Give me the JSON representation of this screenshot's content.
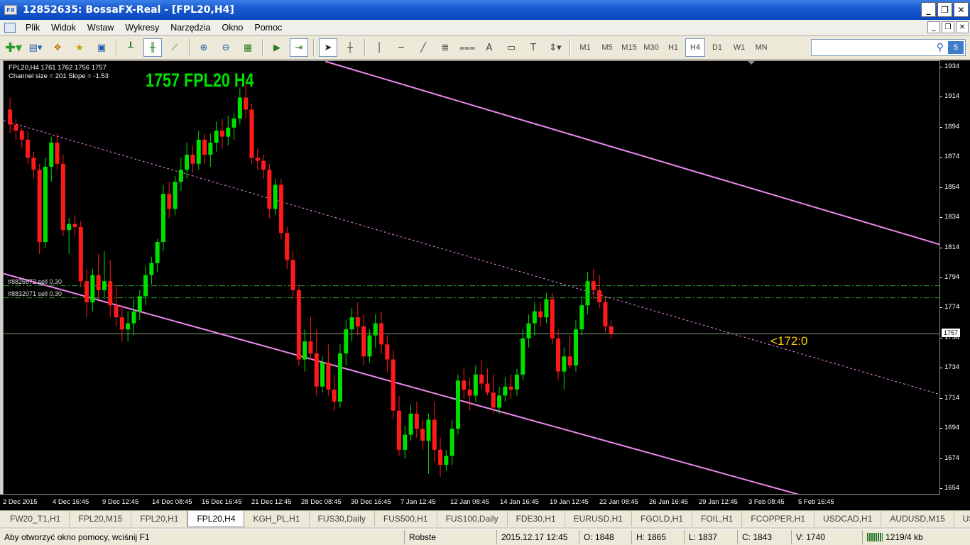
{
  "window": {
    "title": "12852635: BossaFX-Real - [FPL20,H4]",
    "app_icon": "FX"
  },
  "menu": [
    "Plik",
    "Widok",
    "Wstaw",
    "Wykresy",
    "Narzędzia",
    "Okno",
    "Pomoc"
  ],
  "toolbar": {
    "timeframes": [
      "M1",
      "M5",
      "M15",
      "M30",
      "H1",
      "H4",
      "D1",
      "W1",
      "MN"
    ],
    "selected_timeframe": "H4",
    "search_placeholder": "",
    "badge": "5"
  },
  "chart": {
    "info_line1": "FPL20,H4  1761 1762 1756 1757",
    "info_line2": "Channel size = 201 Slope = -1.53",
    "big_label": "1757 FPL20 H4",
    "countdown": "<172:0",
    "order1": "#8826572 sell 0.30",
    "order2": "#8832071 sell 0.30",
    "current_price": "1757",
    "price_labels": [
      "1934",
      "1914",
      "1894",
      "1874",
      "1854",
      "1834",
      "1814",
      "1794",
      "1774",
      "1754",
      "1734",
      "1714",
      "1694",
      "1674",
      "1654"
    ],
    "time_labels": [
      "2 Dec 2015",
      "4 Dec 16:45",
      "9 Dec 12:45",
      "14 Dec 08:45",
      "16 Dec 16:45",
      "21 Dec 12:45",
      "28 Dec 08:45",
      "30 Dec 16:45",
      "7 Jan 12:45",
      "12 Jan 08:45",
      "14 Jan 16:45",
      "19 Jan 12:45",
      "22 Jan 08:45",
      "26 Jan 16:45",
      "29 Jan 12:45",
      "3 Feb 08:45",
      "5 Feb 16:45"
    ],
    "colors": {
      "bull": "#00e000",
      "bear": "#ff1a1a",
      "channel": "#ee88ee",
      "order_line": "#2ea02e",
      "price_line": "#7fa37f",
      "background": "#000000"
    }
  },
  "chart_data": {
    "type": "candlestick",
    "symbol": "FPL20",
    "timeframe": "H4",
    "ylim": [
      1650,
      1938
    ],
    "last_price": 1757,
    "orders": [
      {
        "label": "#8826572 sell 0.30",
        "price": 1789
      },
      {
        "label": "#8832071 sell 0.30",
        "price": 1781
      }
    ],
    "channel": {
      "upper": [
        {
          "bar": 54,
          "price": 1938
        },
        {
          "bar": 222,
          "price": 1742
        }
      ],
      "middle": [
        {
          "bar": 0,
          "price": 1898
        },
        {
          "bar": 214,
          "price": 1653
        }
      ],
      "lower": [
        {
          "bar": 0,
          "price": 1797
        },
        {
          "bar": 128,
          "price": 1652
        }
      ]
    },
    "candles": [
      [
        1906,
        1914,
        1890,
        1896
      ],
      [
        1896,
        1900,
        1886,
        1892
      ],
      [
        1892,
        1894,
        1880,
        1886
      ],
      [
        1886,
        1892,
        1870,
        1874
      ],
      [
        1874,
        1878,
        1860,
        1866
      ],
      [
        1866,
        1870,
        1810,
        1818
      ],
      [
        1818,
        1874,
        1814,
        1868
      ],
      [
        1868,
        1888,
        1858,
        1884
      ],
      [
        1884,
        1890,
        1866,
        1870
      ],
      [
        1870,
        1876,
        1822,
        1826
      ],
      [
        1826,
        1834,
        1810,
        1830
      ],
      [
        1830,
        1836,
        1822,
        1828
      ],
      [
        1828,
        1832,
        1788,
        1792
      ],
      [
        1792,
        1800,
        1768,
        1778
      ],
      [
        1778,
        1800,
        1772,
        1796
      ],
      [
        1796,
        1810,
        1780,
        1786
      ],
      [
        1786,
        1812,
        1780,
        1792
      ],
      [
        1792,
        1806,
        1768,
        1776
      ],
      [
        1776,
        1790,
        1762,
        1768
      ],
      [
        1768,
        1776,
        1752,
        1760
      ],
      [
        1760,
        1772,
        1752,
        1764
      ],
      [
        1764,
        1780,
        1756,
        1772
      ],
      [
        1772,
        1786,
        1766,
        1782
      ],
      [
        1782,
        1802,
        1776,
        1796
      ],
      [
        1796,
        1808,
        1790,
        1804
      ],
      [
        1804,
        1820,
        1798,
        1818
      ],
      [
        1818,
        1856,
        1812,
        1850
      ],
      [
        1850,
        1858,
        1834,
        1840
      ],
      [
        1840,
        1862,
        1836,
        1858
      ],
      [
        1858,
        1874,
        1852,
        1866
      ],
      [
        1866,
        1884,
        1860,
        1876
      ],
      [
        1876,
        1882,
        1864,
        1870
      ],
      [
        1870,
        1892,
        1866,
        1886
      ],
      [
        1886,
        1890,
        1870,
        1876
      ],
      [
        1876,
        1890,
        1868,
        1884
      ],
      [
        1884,
        1898,
        1878,
        1892
      ],
      [
        1892,
        1900,
        1880,
        1888
      ],
      [
        1888,
        1902,
        1882,
        1894
      ],
      [
        1894,
        1904,
        1886,
        1900
      ],
      [
        1900,
        1920,
        1896,
        1914
      ],
      [
        1914,
        1924,
        1900,
        1906
      ],
      [
        1906,
        1910,
        1870,
        1874
      ],
      [
        1874,
        1880,
        1866,
        1872
      ],
      [
        1872,
        1876,
        1860,
        1866
      ],
      [
        1866,
        1870,
        1834,
        1840
      ],
      [
        1840,
        1860,
        1836,
        1856
      ],
      [
        1856,
        1860,
        1820,
        1824
      ],
      [
        1824,
        1828,
        1800,
        1806
      ],
      [
        1806,
        1812,
        1780,
        1786
      ],
      [
        1786,
        1790,
        1736,
        1740
      ],
      [
        1740,
        1760,
        1732,
        1752
      ],
      [
        1752,
        1768,
        1740,
        1744
      ],
      [
        1744,
        1760,
        1716,
        1722
      ],
      [
        1722,
        1742,
        1718,
        1738
      ],
      [
        1738,
        1750,
        1716,
        1720
      ],
      [
        1720,
        1730,
        1706,
        1712
      ],
      [
        1712,
        1750,
        1708,
        1744
      ],
      [
        1744,
        1766,
        1736,
        1760
      ],
      [
        1760,
        1774,
        1752,
        1768
      ],
      [
        1768,
        1778,
        1756,
        1762
      ],
      [
        1762,
        1770,
        1736,
        1742
      ],
      [
        1742,
        1760,
        1738,
        1756
      ],
      [
        1756,
        1770,
        1748,
        1764
      ],
      [
        1764,
        1772,
        1744,
        1750
      ],
      [
        1750,
        1756,
        1732,
        1740
      ],
      [
        1740,
        1746,
        1700,
        1706
      ],
      [
        1706,
        1716,
        1676,
        1680
      ],
      [
        1680,
        1696,
        1674,
        1690
      ],
      [
        1690,
        1710,
        1686,
        1704
      ],
      [
        1704,
        1712,
        1688,
        1694
      ],
      [
        1694,
        1700,
        1680,
        1686
      ],
      [
        1686,
        1704,
        1664,
        1700
      ],
      [
        1700,
        1712,
        1672,
        1680
      ],
      [
        1680,
        1688,
        1662,
        1670
      ],
      [
        1670,
        1680,
        1666,
        1676
      ],
      [
        1676,
        1700,
        1670,
        1694
      ],
      [
        1694,
        1730,
        1690,
        1726
      ],
      [
        1726,
        1734,
        1714,
        1720
      ],
      [
        1720,
        1728,
        1706,
        1716
      ],
      [
        1716,
        1736,
        1712,
        1730
      ],
      [
        1730,
        1740,
        1720,
        1724
      ],
      [
        1724,
        1734,
        1716,
        1718
      ],
      [
        1718,
        1730,
        1704,
        1708
      ],
      [
        1708,
        1722,
        1704,
        1716
      ],
      [
        1716,
        1728,
        1712,
        1722
      ],
      [
        1722,
        1730,
        1714,
        1720
      ],
      [
        1720,
        1734,
        1716,
        1730
      ],
      [
        1730,
        1760,
        1726,
        1754
      ],
      [
        1754,
        1770,
        1748,
        1764
      ],
      [
        1764,
        1778,
        1756,
        1772
      ],
      [
        1772,
        1778,
        1762,
        1768
      ],
      [
        1768,
        1784,
        1764,
        1780
      ],
      [
        1780,
        1784,
        1750,
        1754
      ],
      [
        1754,
        1760,
        1726,
        1732
      ],
      [
        1732,
        1748,
        1720,
        1742
      ],
      [
        1742,
        1756,
        1734,
        1736
      ],
      [
        1736,
        1766,
        1732,
        1760
      ],
      [
        1760,
        1782,
        1756,
        1776
      ],
      [
        1776,
        1798,
        1770,
        1792
      ],
      [
        1792,
        1800,
        1780,
        1786
      ],
      [
        1786,
        1796,
        1774,
        1778
      ],
      [
        1778,
        1782,
        1758,
        1762
      ],
      [
        1762,
        1766,
        1754,
        1757
      ]
    ]
  },
  "tabs": [
    "FW20_T1,H1",
    "FPL20,M15",
    "FPL20,H1",
    "FPL20,H4",
    "KGH_PL,H1",
    "FUS30,Daily",
    "FUS500,H1",
    "FUS100,Daily",
    "FDE30,H1",
    "EURUSD,H1",
    "FGOLD,H1",
    "FOIL,H1",
    "FCOPPER,H1",
    "USDCAD,H1",
    "AUDUSD,M15",
    "USD"
  ],
  "active_tab": "FPL20,H4",
  "status": {
    "help": "Aby otworzyć okno pomocy, wciśnij F1",
    "profile": "Robste",
    "datetime": "2015.12.17 12:45",
    "open": "O: 1848",
    "high": "H: 1865",
    "low": "L: 1837",
    "close": "C: 1843",
    "volume": "V: 1740",
    "traffic": "1219/4 kb"
  }
}
